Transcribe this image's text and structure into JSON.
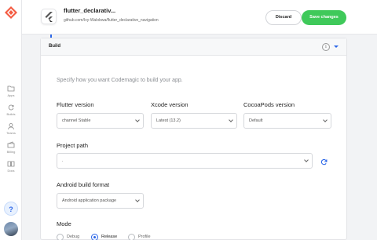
{
  "rail": {
    "items": [
      {
        "label": "Apps",
        "icon": "folder-icon"
      },
      {
        "label": "Builds",
        "icon": "refresh-icon"
      },
      {
        "label": "Teams",
        "icon": "user-icon"
      },
      {
        "label": "Billing",
        "icon": "wallet-icon"
      },
      {
        "label": "Docs",
        "icon": "book-icon"
      }
    ],
    "help_label": "?"
  },
  "header": {
    "app_name": "flutter_declarativ...",
    "repo": "github.com/Ivy-Walobwa/flutter_declarative_navigation",
    "discard_label": "Discard",
    "save_label": "Save changes"
  },
  "panel": {
    "title": "Build",
    "info_label": "i",
    "intro": "Specify how you want Codemagic to build your app.",
    "flutter": {
      "label": "Flutter version",
      "value": "channel Stable"
    },
    "xcode": {
      "label": "Xcode version",
      "value": "Latest (13.2)"
    },
    "cocoapods": {
      "label": "CocoaPods version",
      "value": "Default"
    },
    "project_path": {
      "label": "Project path",
      "value": "."
    },
    "android_format": {
      "label": "Android build format",
      "value": "Android application package"
    },
    "mode": {
      "label": "Mode",
      "options": [
        "Debug",
        "Release",
        "Profile"
      ],
      "selected": "Release"
    }
  },
  "colors": {
    "accent": "#2b66e8",
    "save": "#3fc95a",
    "brand": "#f45c43"
  }
}
